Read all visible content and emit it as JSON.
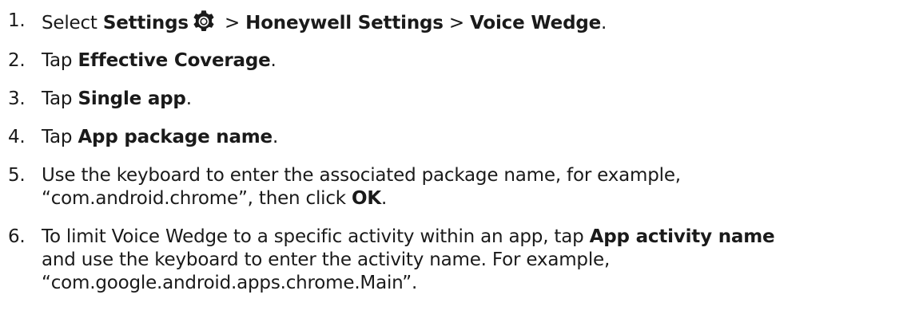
{
  "steps": [
    {
      "num": "1.",
      "pre": "Select ",
      "b1": "Settings",
      "icon": "settings-gear-icon",
      "sep1": " > ",
      "b2": "Honeywell Settings",
      "sep2": " > ",
      "b3": "Voice Wedge",
      "post": "."
    },
    {
      "num": "2.",
      "pre": "Tap ",
      "bold": "Effective Coverage",
      "post": "."
    },
    {
      "num": "3.",
      "pre": "Tap ",
      "bold": "Single app",
      "post": "."
    },
    {
      "num": "4.",
      "pre": "Tap ",
      "bold": "App package name",
      "post": "."
    },
    {
      "num": "5.",
      "line1": "Use the keyboard to enter the associated package name, for example,",
      "line2_pre": "“com.android.chrome”, then click ",
      "bold": "OK",
      "post": "."
    },
    {
      "num": "6.",
      "line1_pre": "To limit Voice Wedge to a specific activity within an app, tap ",
      "bold": "App activity name",
      "line2": "and use the keyboard to enter the activity name. For example,",
      "line3": "“com.google.android.apps.chrome.Main”."
    }
  ],
  "colors": {
    "text": "#1a1a1a",
    "icon": "#1a1a1a"
  }
}
